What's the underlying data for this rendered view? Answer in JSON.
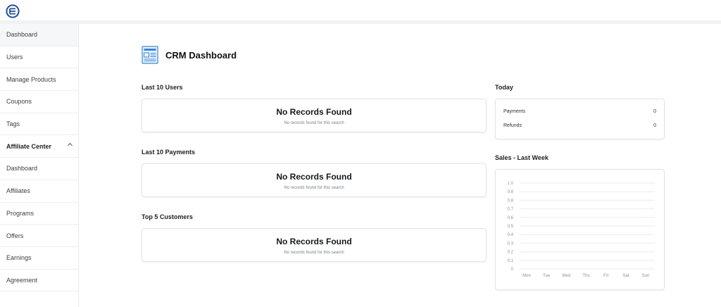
{
  "header": {
    "logo_icon": "circle-e-logo"
  },
  "sidebar": {
    "items": [
      {
        "label": "Dashboard"
      },
      {
        "label": "Users"
      },
      {
        "label": "Manage Products"
      },
      {
        "label": "Coupons"
      },
      {
        "label": "Tags"
      },
      {
        "label": "Affiliate Center"
      },
      {
        "label": "Dashboard"
      },
      {
        "label": "Affiliates"
      },
      {
        "label": "Programs"
      },
      {
        "label": "Offers"
      },
      {
        "label": "Earnings"
      },
      {
        "label": "Agreement"
      }
    ]
  },
  "main": {
    "title": "CRM Dashboard",
    "sections": [
      {
        "label": "Last 10 Users",
        "empty_title": "No Records Found",
        "empty_sub": "No records found for this search"
      },
      {
        "label": "Last 10 Payments",
        "empty_title": "No Records Found",
        "empty_sub": "No records found for this search"
      },
      {
        "label": "Top 5 Customers",
        "empty_title": "No Records Found",
        "empty_sub": "No records found for this search"
      }
    ],
    "today": {
      "label": "Today",
      "rows": [
        {
          "label": "Payments",
          "value": "0"
        },
        {
          "label": "Refunds",
          "value": "0"
        }
      ]
    },
    "sales": {
      "label": "Sales - Last Week"
    }
  },
  "chart_data": {
    "type": "line",
    "categories": [
      "Mon",
      "Tue",
      "Wed",
      "Thu",
      "Fri",
      "Sat",
      "Sun"
    ],
    "series": [
      {
        "values": [
          0,
          0,
          0,
          0,
          0,
          0,
          0
        ]
      }
    ],
    "ylim": [
      0,
      1.0
    ],
    "yticks": [
      "1.0",
      "0.9",
      "0.8",
      "0.7",
      "0.6",
      "0.5",
      "0.4",
      "0.3",
      "0.2",
      "0.1",
      "0"
    ],
    "grid": true
  },
  "colors": {
    "accent_blue": "#1e5aa8",
    "icon_blue": "#3b86d6"
  }
}
